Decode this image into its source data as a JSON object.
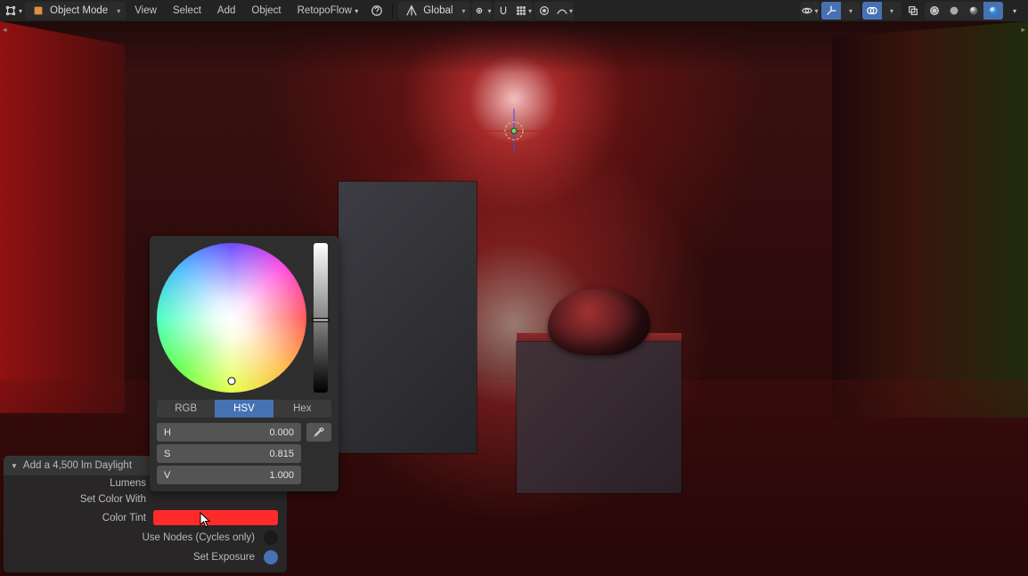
{
  "header": {
    "mode_label": "Object Mode",
    "menus": [
      "View",
      "Select",
      "Add",
      "Object"
    ],
    "extra_menu": "RetopoFlow",
    "orientation_label": "Global"
  },
  "op_panel": {
    "title": "Add a 4,500 lm Daylight",
    "lumens_label": "Lumens",
    "set_color_label": "Set Color With",
    "color_tint_label": "Color Tint",
    "use_nodes_label": "Use Nodes (Cycles only)",
    "set_exposure_label": "Set Exposure"
  },
  "picker": {
    "tabs": {
      "rgb": "RGB",
      "hsv": "HSV",
      "hex": "Hex"
    },
    "h": {
      "label": "H",
      "value": "0.000"
    },
    "s": {
      "label": "S",
      "value": "0.815"
    },
    "v": {
      "label": "V",
      "value": "1.000"
    }
  }
}
